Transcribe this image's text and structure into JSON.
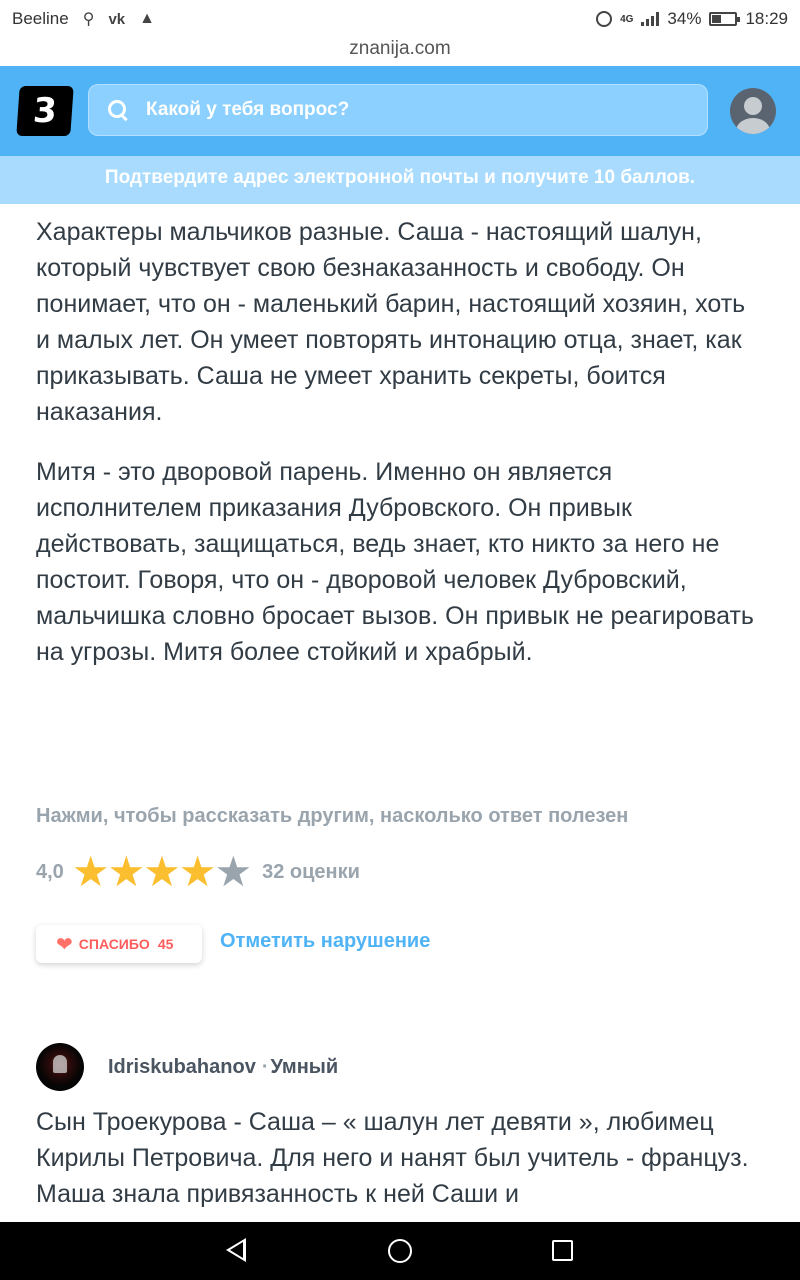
{
  "status_bar": {
    "carrier": "Beeline",
    "battery": "34%",
    "time": "18:29",
    "network": "4G"
  },
  "browser": {
    "url": "znanija.com"
  },
  "header": {
    "logo_letter": "3",
    "search_placeholder": "Какой у тебя вопрос?"
  },
  "banner": {
    "text": "Подтвердите адрес электронной почты и получите 10 баллов."
  },
  "answer": {
    "paragraphs": [
      "Характеры мальчиков разные. Саша - настоящий шалун, который чувствует свою безнаказанность и свободу. Он понимает, что он - маленький барин, настоящий хозяин, хоть и малых лет. Он умеет повторять интонацию отца, знает, как приказывать. Саша не умеет хранить секреты, боится наказания.",
      "Митя - это дворовой парень. Именно он является исполнителем приказания Дубровского. Он привык действовать, защищаться, ведь знает, кто никто за него не постоит. Говоря, что он - дворовой человек Дубровский, мальчишка словно бросает вызов. Он привык не реагировать на угрозы. Митя более стойкий и храбрый."
    ],
    "rate_prompt": "Нажми, чтобы рассказать другим, насколько ответ полезен",
    "rating_value": "4,0",
    "rating_stars": 4,
    "rating_max": 5,
    "rating_count": "32 оценки",
    "thanks_label": "СПАСИБО",
    "thanks_count": "45",
    "report_label": "Отметить нарушение"
  },
  "answer2": {
    "username": "Idriskubahanov",
    "rank": "Умный",
    "text": "Сын Троекурова - Саша – « шалун лет девяти », любимец Кирилы Петровича. Для него и нанят был учитель - француз. Маша знала привязанность к ней Саши и"
  },
  "colors": {
    "brand_blue": "#4fb3f6",
    "banner_blue": "#a9dbff",
    "star_gold": "#fbbe2e",
    "muted_gray": "#9aa4ad",
    "heart_red": "#ff7066"
  }
}
